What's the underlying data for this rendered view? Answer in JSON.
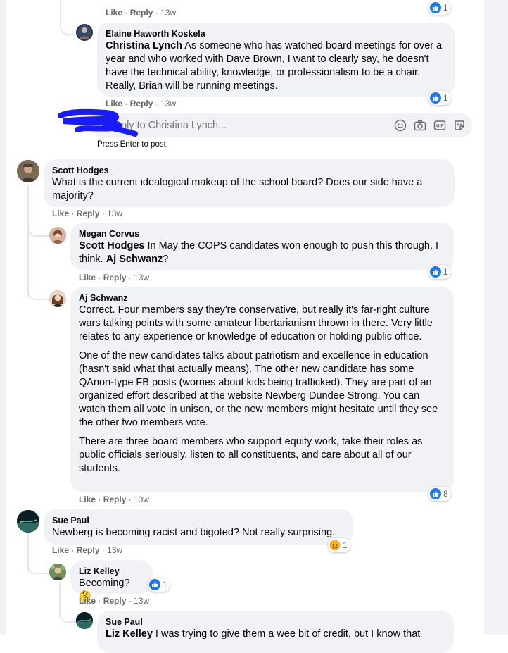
{
  "comments": {
    "top_stub": {
      "like": "Like",
      "reply": "Reply",
      "time": "13w",
      "reactions": "1"
    },
    "elaine": {
      "author": "Elaine Haworth Koskela",
      "mention": "Christina Lynch",
      "text": " As someone who has watched board meetings for over a year and who worked with Dave Brown, I want to clearly say, he doesn't have the technical ability, knowledge, or professionalism to be a chair. Really, Brian will be running meetings.",
      "like": "Like",
      "reply": "Reply",
      "time": "13w",
      "reactions": "1"
    },
    "reply_box": {
      "placeholder": "ply to Christina Lynch...",
      "hint": "Press Enter to post."
    },
    "scott": {
      "author": "Scott Hodges",
      "text": "What is the current idealogical makeup of the school board? Does our side have a majority?",
      "like": "Like",
      "reply": "Reply",
      "time": "13w"
    },
    "megan": {
      "author": "Megan Corvus",
      "mention1": "Scott Hodges",
      "text1": " In May the COPS candidates won enough to push this through, I think. ",
      "mention2": "Aj Schwanz",
      "text2": "?",
      "like": "Like",
      "reply": "Reply",
      "time": "13w",
      "reactions": "1"
    },
    "aj": {
      "author": "Aj Schwanz",
      "paragraphs": [
        "Correct. Four members say they're conservative, but really it's far-right culture wars talking points with some amateur libertarianism thrown in there. Very little relates to any experience or knowledge of education or holding public office.",
        "One of the new candidates talks about patriotism and excellence in education (hasn't said what that actually means). The other new candidate has some QAnon-type FB posts (worries about kids being trafficked). They are part of an organized effort described at the website Newberg Dundee Strong. You can watch them all vote in unison, or the new members might hesitate until they see the other two members vote.",
        "There are three board members who support equity work, take their roles as public officials seriously, listen to all constituents, and care about all of our students."
      ],
      "like": "Like",
      "reply": "Reply",
      "time": "13w",
      "reactions": "8"
    },
    "sue": {
      "author": "Sue Paul",
      "text": "Newberg is becoming racist and bigoted? Not really surprising.",
      "like": "Like",
      "reply": "Reply",
      "time": "13w",
      "reactions": "1"
    },
    "liz": {
      "author": "Liz Kelley",
      "text": "Becoming? 🤔",
      "like": "Like",
      "reply": "Reply",
      "time": "13w",
      "reactions": "1"
    },
    "sue2": {
      "author": "Sue Paul",
      "mention": "Liz Kelley",
      "text": " I was trying to give them a wee bit of credit, but I know that"
    }
  },
  "icons": [
    "like-icon",
    "sad-icon",
    "emoji-icon",
    "camera-icon",
    "gif-icon",
    "sticker-icon"
  ],
  "colors": {
    "like_blue": "#1877f2",
    "bubble": "#f0f2f5",
    "meta_gray": "#65676b",
    "scribble": "#1a1aff"
  }
}
